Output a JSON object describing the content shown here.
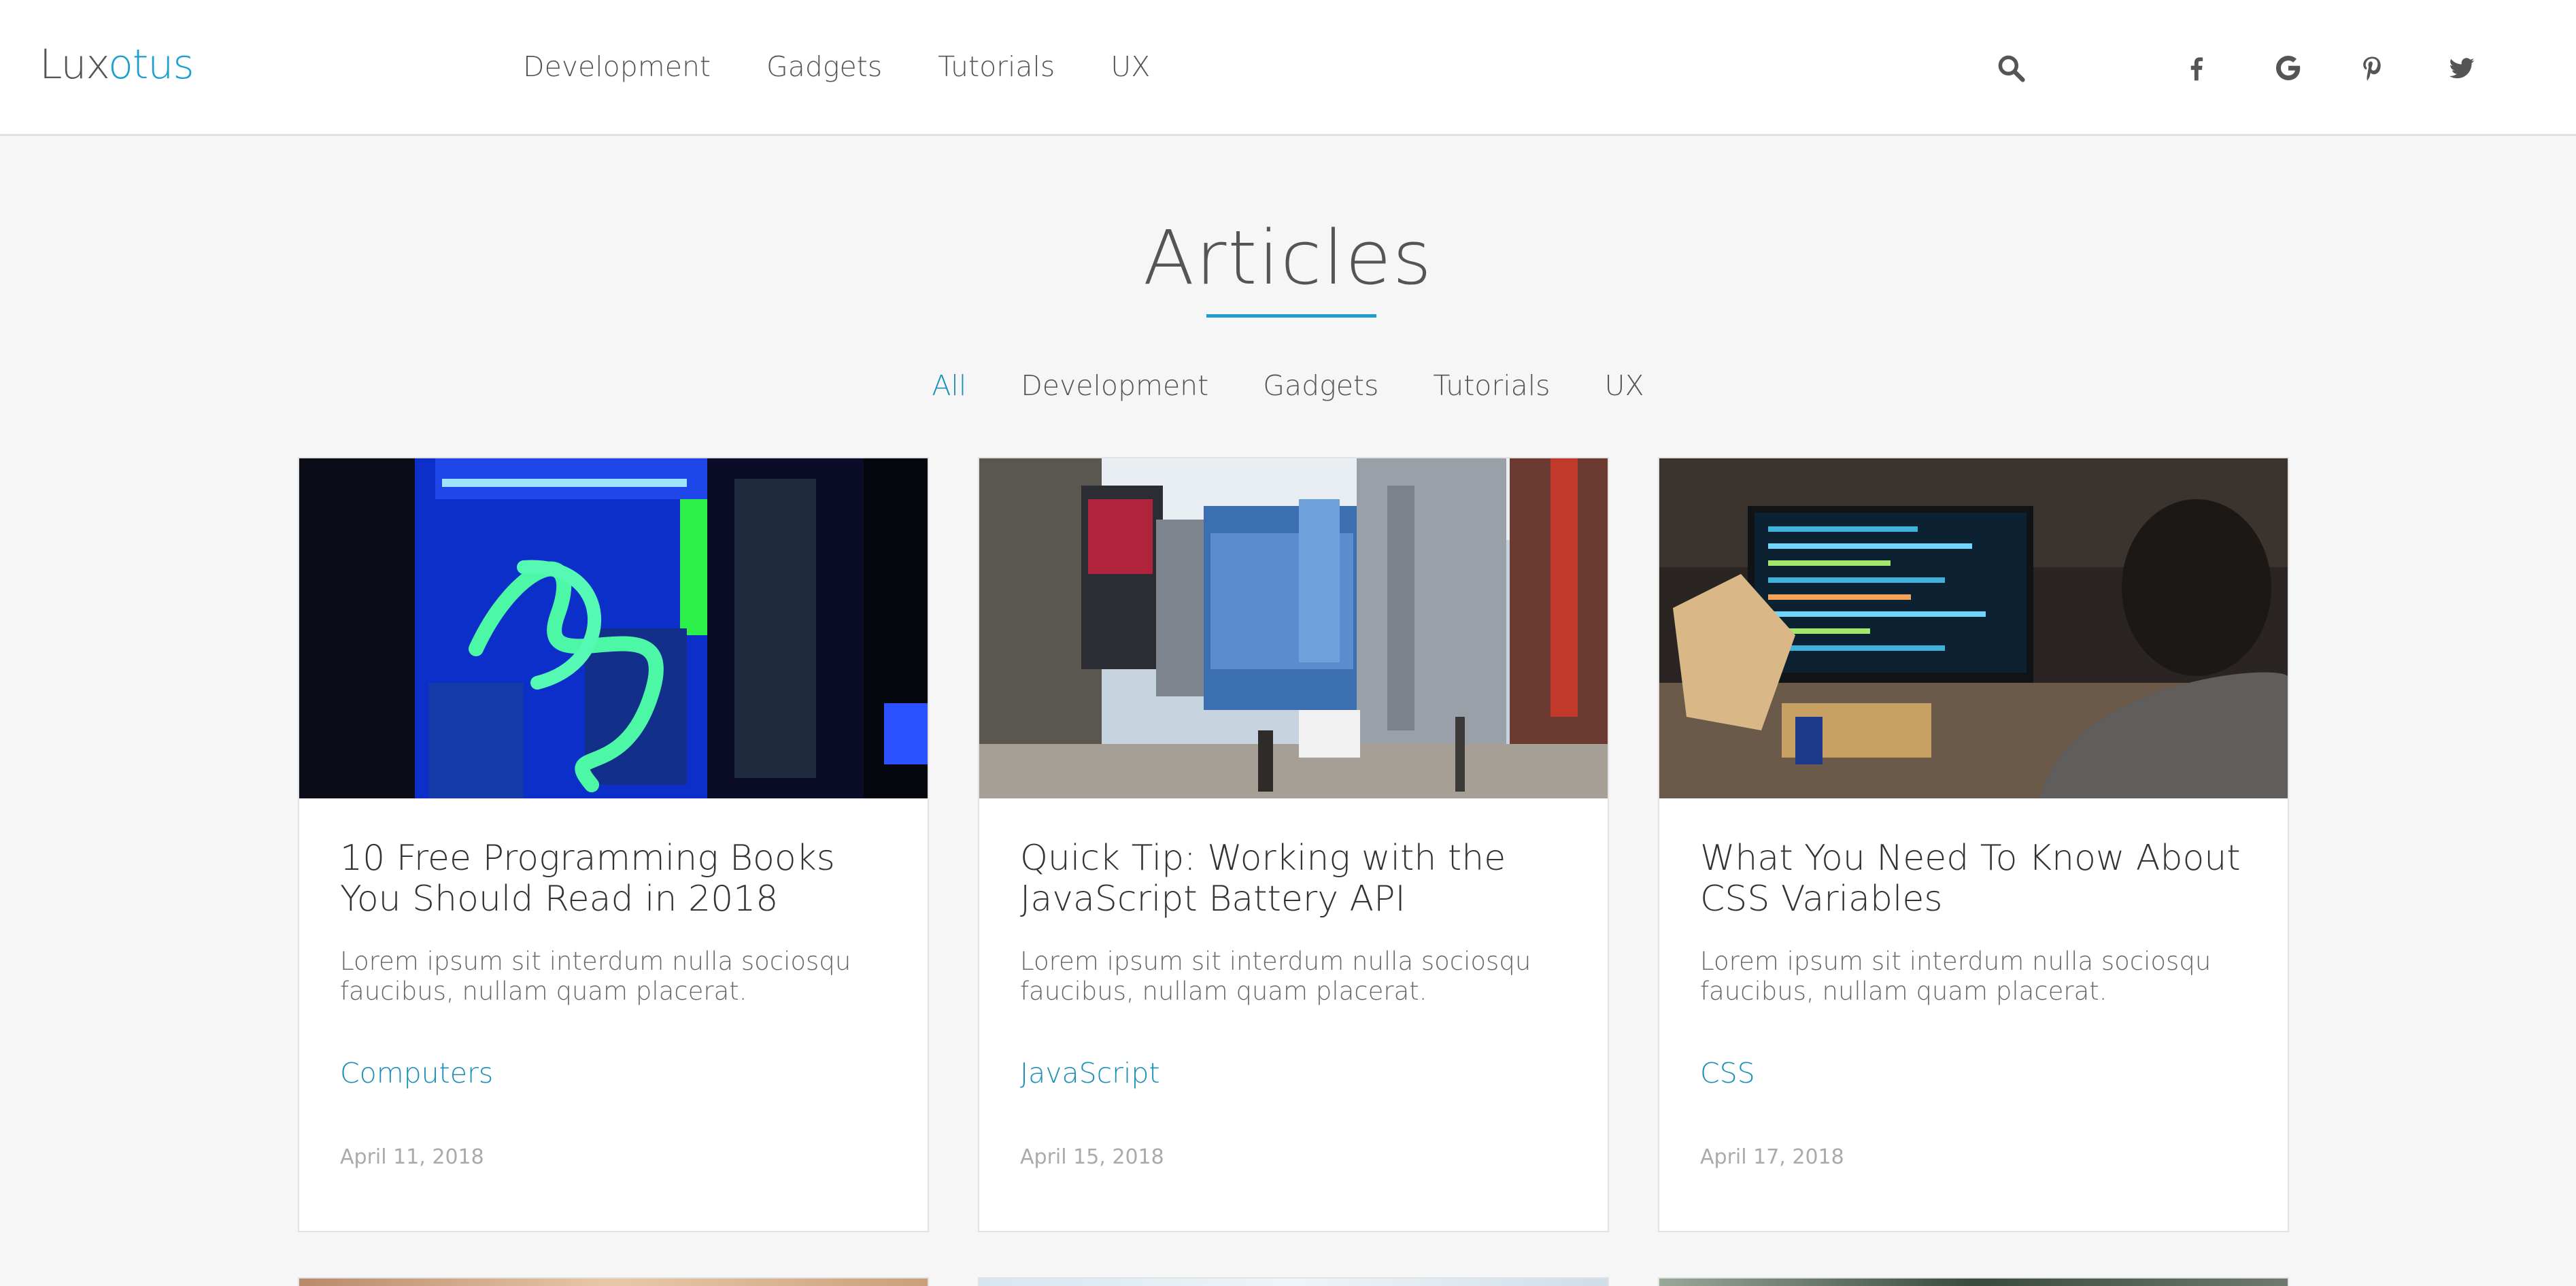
{
  "header": {
    "logo_part1": "Lux",
    "logo_part2": "otus",
    "nav": [
      "Development",
      "Gadgets",
      "Tutorials",
      "UX"
    ],
    "icons": {
      "search": "search-icon",
      "social": [
        "facebook-icon",
        "google-icon",
        "pinterest-icon",
        "twitter-icon"
      ]
    }
  },
  "main": {
    "title": "Articles",
    "filters": [
      "All",
      "Development",
      "Gadgets",
      "Tutorials",
      "UX"
    ],
    "active_filter": "All",
    "cards": [
      {
        "title": "10 Free Programming Books You Should Read in 2018",
        "excerpt": "Lorem ipsum sit interdum nulla sociosqu faucibus, nullam quam placerat.",
        "category": "Computers",
        "date": "April 11, 2018"
      },
      {
        "title": "Quick Tip: Working with the JavaScript Battery API",
        "excerpt": "Lorem ipsum sit interdum nulla sociosqu faucibus, nullam quam placerat.",
        "category": "JavaScript",
        "date": "April 15, 2018"
      },
      {
        "title": "What You Need To Know About CSS Variables",
        "excerpt": "Lorem ipsum sit interdum nulla sociosqu faucibus, nullam quam placerat.",
        "category": "CSS",
        "date": "April 17, 2018"
      }
    ]
  },
  "colors": {
    "accent": "#1a9fd0",
    "link": "#1a8fb9",
    "background": "#f6f6f6",
    "text": "#555555"
  }
}
